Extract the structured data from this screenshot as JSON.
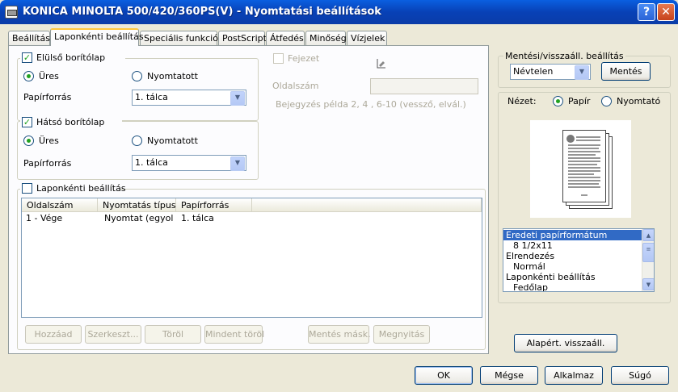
{
  "window": {
    "title": "KONICA MINOLTA 500/420/360PS(V) - Nyomtatási beállítások",
    "help_button": "?",
    "close_button": "✕"
  },
  "tabs": [
    {
      "label": "Beállítás"
    },
    {
      "label": "Laponkénti beállítás"
    },
    {
      "label": "Speciális funkciók"
    },
    {
      "label": "PostScript"
    },
    {
      "label": "Átfedés"
    },
    {
      "label": "Minőség"
    },
    {
      "label": "Vízjelek"
    }
  ],
  "front_cover": {
    "label": "Elülső borítólap",
    "checked": "✓",
    "radio_blank": "Üres",
    "radio_printed": "Nyomtatott",
    "source_label": "Papírforrás",
    "source_value": "1. tálca"
  },
  "chapter": {
    "label": "Fejezet",
    "page_number_label": "Oldalszám",
    "example_text": "Bejegyzés példa 2, 4 , 6-10 (vessző, elvál.)"
  },
  "back_cover": {
    "label": "Hátsó borítólap",
    "checked": "✓",
    "radio_blank": "Üres",
    "radio_printed": "Nyomtatott",
    "source_label": "Papírforrás",
    "source_value": "1. tálca"
  },
  "per_page": {
    "label": "Laponkénti beállítás",
    "columns": [
      "Oldalszám",
      "Nyomtatás típusa",
      "Papírforrás"
    ],
    "rows": [
      {
        "page": "1 - Vége",
        "type": "Nyomtat (egyol...",
        "source": "1. tálca"
      }
    ],
    "buttons": {
      "add": "Hozzáad",
      "edit": "Szerkeszt...",
      "delete": "Töröl",
      "delete_all": "Mindent töröl",
      "save_as": "Mentés másk.",
      "open": "Megnyitás"
    }
  },
  "save_settings": {
    "label": "Mentési/visszaáll. beállítás",
    "select_value": "Névtelen",
    "save_button": "Mentés"
  },
  "view": {
    "label": "Nézet:",
    "radio_paper": "Papír",
    "radio_printer": "Nyomtató"
  },
  "summary_list": [
    {
      "text": "Eredeti papírformátum",
      "selected": true
    },
    {
      "text": "8 1/2x11",
      "indent": true
    },
    {
      "text": "Elrendezés"
    },
    {
      "text": "Normál",
      "indent": true
    },
    {
      "text": "Laponkénti beállítás"
    },
    {
      "text": "Fedőlap",
      "indent": true
    }
  ],
  "restore_defaults_button": "Alapért. visszaáll.",
  "footer": {
    "ok": "OK",
    "cancel": "Mégse",
    "apply": "Alkalmaz",
    "help": "Súgó"
  },
  "colors": {
    "titlebar": "#0a5fe0",
    "dialog_bg": "#ece9d8",
    "selection": "#316ac5",
    "tab_highlight": "#ffc73c"
  }
}
